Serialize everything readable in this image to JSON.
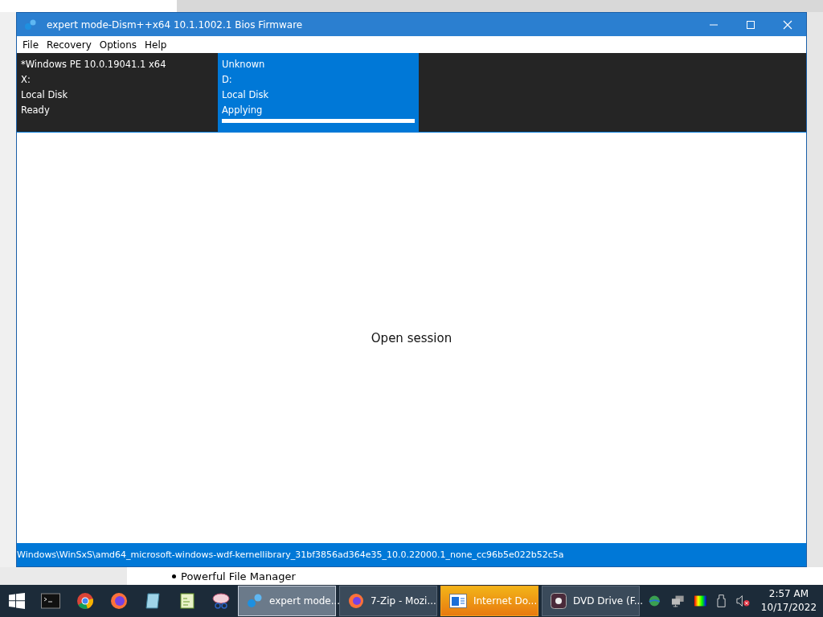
{
  "window": {
    "title": "expert mode-Dism++x64 10.1.1002.1 Bios Firmware"
  },
  "menu": [
    "File",
    "Recovery",
    "Options",
    "Help"
  ],
  "sessions": [
    {
      "lines": [
        "*Windows PE 10.0.19041.1 x64",
        "X:",
        "Local Disk",
        "Ready"
      ],
      "selected": false
    },
    {
      "lines": [
        "Unknown",
        "D:",
        "Local Disk",
        "Applying"
      ],
      "selected": true,
      "level": 1.0
    }
  ],
  "content": {
    "message": "Open session"
  },
  "status_bar": "Windows\\WinSxS\\amd64_microsoft-windows-wdf-kernellibrary_31bf3856ad364e35_10.0.22000.1_none_cc96b5e022b52c5a",
  "background_page": {
    "list_item": "Powerful File Manager"
  },
  "taskbar": {
    "tasks": [
      {
        "label": "expert mode...",
        "selected": true,
        "flashing": false
      },
      {
        "label": "7-Zip - Mozi...",
        "selected": false,
        "flashing": false
      },
      {
        "label": "Internet Do...",
        "selected": false,
        "flashing": true
      },
      {
        "label": "DVD Drive (F...",
        "selected": false,
        "flashing": false
      }
    ],
    "clock": {
      "time": "2:57 AM",
      "date": "10/17/2022"
    }
  }
}
